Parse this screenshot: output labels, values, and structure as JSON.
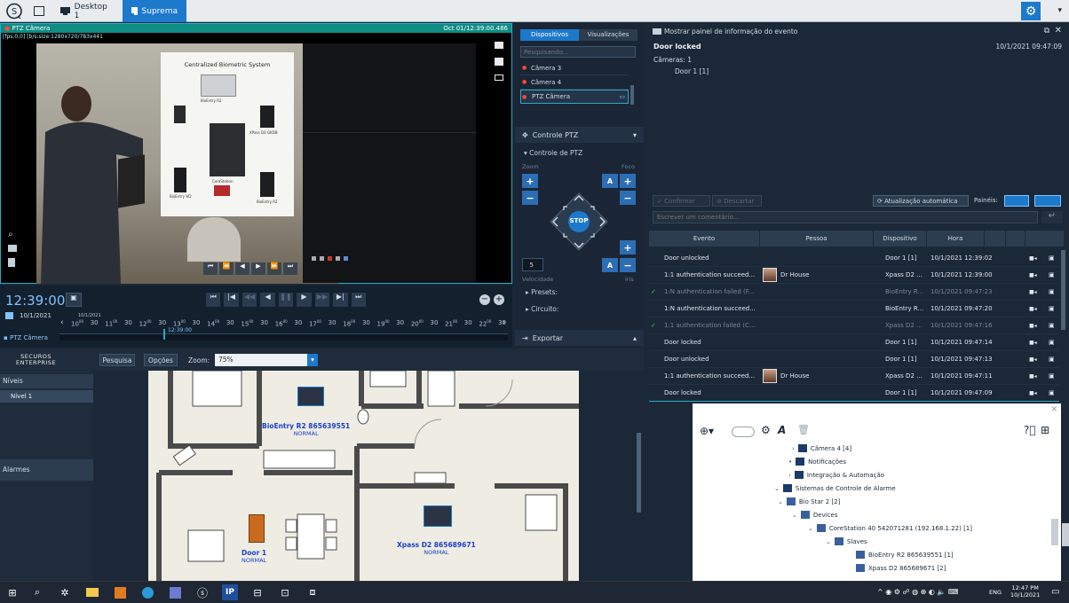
{
  "top_tabs": {
    "desktop": "Desktop 1",
    "suprema": "Suprema"
  },
  "video": {
    "camera_name": "PTZ Câmera",
    "timestamp": "Oct 01/12:39:00.486",
    "resolution": "[fps:0,0] [b/s:size:1280x720/783x441",
    "board_title": "Centralized Biometric System",
    "board_labels": [
      "BioEntry R2",
      "XPass D2-GKDB",
      "CoreStation",
      "BioEntry W2",
      "BioEntry R2"
    ]
  },
  "timeline": {
    "time": "12:39:00",
    "date": "10/1/2021",
    "camera": "PTZ Câmera",
    "cursor_label": "12:39:00",
    "start_label": "10/1/2021",
    "hours": [
      "10",
      "11",
      "12",
      "13",
      "14",
      "15",
      "16",
      "17",
      "18",
      "19",
      "20",
      "21",
      "22"
    ],
    "half_label": "30",
    "minute_suffix": "00"
  },
  "ptz": {
    "tabs": [
      "Dispositivos",
      "Visualizações"
    ],
    "search_placeholder": "Pesquisando...",
    "cameras": [
      "Câmera 3",
      "Câmera 4",
      "PTZ Câmera"
    ],
    "section_title": "Controle PTZ",
    "sub_title": "Controle de PTZ",
    "zoom_label": "Zoom",
    "focus_label": "Foco",
    "stop_label": "STOP",
    "speed_value": "5",
    "speed_label": "Velocidade",
    "iris_label": "Íris",
    "auto_label": "A",
    "presets": "Presets:",
    "circuit": "Circuito:",
    "export": "Exportar"
  },
  "event_info": {
    "header": "Mostrar painel de informação do evento",
    "event": "Door locked",
    "time": "10/1/2021 09:47:09",
    "cameras": "Câmeras: 1",
    "camera_item": "Door 1 [1]",
    "confirm": "Confirmar",
    "discard": "Descartar",
    "auto_update": "Atualização automática",
    "panels": "Painéis:",
    "comment_placeholder": "Escrever um comentário..."
  },
  "events_table": {
    "headers": [
      "Evento",
      "Pessoa",
      "Dispositivo",
      "Hora"
    ],
    "rows": [
      {
        "event": "Door unlocked",
        "person": "",
        "device": "Door 1 [1]",
        "time": "10/1/2021 12:39:02",
        "check": false,
        "dim": false
      },
      {
        "event": "1:1 authentication succeed...",
        "person": "Dr House",
        "device": "Xpass D2 ...",
        "time": "10/1/2021 12:39:00",
        "check": false,
        "dim": false
      },
      {
        "event": "1:N authentication failed (F...",
        "person": "",
        "device": "BioEntry R...",
        "time": "10/1/2021 09:47:23",
        "check": true,
        "dim": true
      },
      {
        "event": "1:N authentication succeed...",
        "person": "",
        "device": "BioEntry R...",
        "time": "10/1/2021 09:47:20",
        "check": false,
        "dim": false
      },
      {
        "event": "1:1 authentication failed (C...",
        "person": "",
        "device": "Xpass D2 ...",
        "time": "10/1/2021 09:47:16",
        "check": true,
        "dim": true
      },
      {
        "event": "Door locked",
        "person": "",
        "device": "Door 1 [1]",
        "time": "10/1/2021 09:47:14",
        "check": false,
        "dim": false
      },
      {
        "event": "Door unlocked",
        "person": "",
        "device": "Door 1 [1]",
        "time": "10/1/2021 09:47:13",
        "check": false,
        "dim": false
      },
      {
        "event": "1:1 authentication succeed...",
        "person": "Dr House",
        "device": "Xpass D2 ...",
        "time": "10/1/2021 09:47:11",
        "check": false,
        "dim": false
      },
      {
        "event": "Door locked",
        "person": "",
        "device": "Door 1 [1]",
        "time": "10/1/2021 09:47:09",
        "check": false,
        "dim": false
      }
    ]
  },
  "map": {
    "logo_line1": "SECURОS",
    "logo_line2": "ENTERPRISE",
    "search_btn": "Pesquisa",
    "options_btn": "Opções",
    "zoom_label": "Zoom:",
    "zoom_value": "75%",
    "levels_title": "Níveis",
    "level_item": "Nível 1",
    "alarms_title": "Alarmes",
    "devices": [
      {
        "name": "BioEntry R2 865639551",
        "status": "NORMAL"
      },
      {
        "name": "Xpass D2 865689671",
        "status": "NORMAL"
      },
      {
        "name": "Door 1",
        "status": "NORMAL"
      }
    ]
  },
  "tree": {
    "items": [
      {
        "label": "Câmera 4 [4]",
        "level": 0
      },
      {
        "label": "Notificações",
        "level": 0
      },
      {
        "label": "Integração & Automação",
        "level": 0
      },
      {
        "label": "Sistemas de Controle de Alarme",
        "level": 0
      },
      {
        "label": "Bio Star 2 [2]",
        "level": 1
      },
      {
        "label": "Devices",
        "level": 2
      },
      {
        "label": "CoreStation 40 542071281 (192.168.1.22) [1]",
        "level": 3
      },
      {
        "label": "Slaves",
        "level": 4
      },
      {
        "label": "BioEntry R2 865639551 [1]",
        "level": 5
      },
      {
        "label": "Xpass D2 865689671 [2]",
        "level": 5
      }
    ]
  },
  "taskbar": {
    "time": "12:47 PM",
    "date": "10/1/2021",
    "lang": "ENG"
  }
}
